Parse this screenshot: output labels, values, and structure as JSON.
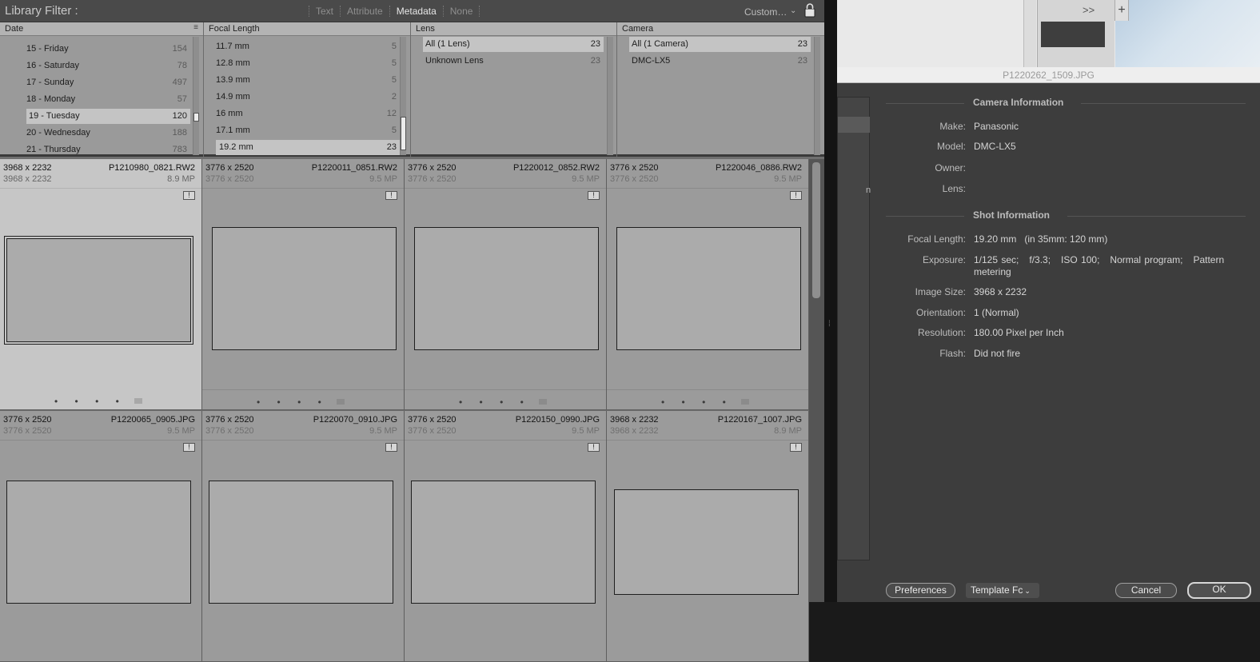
{
  "library_filter": {
    "title": "Library Filter :",
    "modes": [
      "Text",
      "Attribute",
      "Metadata",
      "None"
    ],
    "active_mode": "Metadata",
    "preset": "Custom…",
    "preset_chevron": "⌄"
  },
  "columns": {
    "date": {
      "header": "Date",
      "rows": [
        {
          "label": "15 - Friday",
          "count": "154"
        },
        {
          "label": "16 - Saturday",
          "count": "78"
        },
        {
          "label": "17 - Sunday",
          "count": "497"
        },
        {
          "label": "18 - Monday",
          "count": "57"
        },
        {
          "label": "19 - Tuesday",
          "count": "120"
        },
        {
          "label": "20 - Wednesday",
          "count": "188"
        },
        {
          "label": "21 - Thursday",
          "count": "783"
        }
      ],
      "selected_index": 4
    },
    "focal_length": {
      "header": "Focal Length",
      "rows": [
        {
          "label": "11.7 mm",
          "count": "5"
        },
        {
          "label": "12.8 mm",
          "count": "5"
        },
        {
          "label": "13.9 mm",
          "count": "5"
        },
        {
          "label": "14.9 mm",
          "count": "2"
        },
        {
          "label": "16 mm",
          "count": "12"
        },
        {
          "label": "17.1 mm",
          "count": "5"
        },
        {
          "label": "19.2 mm",
          "count": "23"
        }
      ],
      "selected_index": 6
    },
    "lens": {
      "header": "Lens",
      "rows": [
        {
          "label": "All (1 Lens)",
          "count": "23"
        },
        {
          "label": "Unknown Lens",
          "count": "23"
        }
      ],
      "selected_index": 0
    },
    "camera": {
      "header": "Camera",
      "rows": [
        {
          "label": "All (1 Camera)",
          "count": "23"
        },
        {
          "label": "DMC-LX5",
          "count": "23"
        }
      ],
      "selected_index": 0
    }
  },
  "grid": [
    {
      "dims": "3968 x 2232",
      "fname": "P1210980_0821.RW2",
      "dims2": "3968 x 2232",
      "mp": "8.9 MP",
      "selected": true
    },
    {
      "dims": "3776 x 2520",
      "fname": "P1220011_0851.RW2",
      "dims2": "3776 x 2520",
      "mp": "9.5 MP"
    },
    {
      "dims": "3776 x 2520",
      "fname": "P1220012_0852.RW2",
      "dims2": "3776 x 2520",
      "mp": "9.5 MP"
    },
    {
      "dims": "3776 x 2520",
      "fname": "P1220046_0886.RW2",
      "dims2": "3776 x 2520",
      "mp": "9.5 MP"
    },
    {
      "dims": "3776 x 2520",
      "fname": "P1220065_0905.JPG",
      "dims2": "3776 x 2520",
      "mp": "9.5 MP"
    },
    {
      "dims": "3776 x 2520",
      "fname": "P1220070_0910.JPG",
      "dims2": "3776 x 2520",
      "mp": "9.5 MP"
    },
    {
      "dims": "3776 x 2520",
      "fname": "P1220150_0990.JPG",
      "dims2": "3776 x 2520",
      "mp": "9.5 MP"
    },
    {
      "dims": "3968 x 2232",
      "fname": "P1220167_1007.JPG",
      "dims2": "3968 x 2232",
      "mp": "8.9 MP"
    }
  ],
  "grid_labels": {
    "warning_glyph": "!",
    "dots": "• • • • •"
  },
  "browser": {
    "overflow_chevron": ">>",
    "new_tab": "+"
  },
  "info_window": {
    "title": "P1220262_1509.JPG",
    "camera_section": "Camera Information",
    "camera_fields": [
      {
        "key": "Make:",
        "value": "Panasonic"
      },
      {
        "key": "Model:",
        "value": "DMC-LX5"
      },
      {
        "key": "Owner:",
        "value": ""
      },
      {
        "key": "Lens:",
        "value": ""
      }
    ],
    "shot_section": "Shot Information",
    "shot_fields": [
      {
        "key": "Focal Length:",
        "value": "19.20 mm   (in 35mm: 120 mm)"
      },
      {
        "key": "Exposure:",
        "value": "1/125 sec;   f/3.3;   ISO 100;   Normal program;   Pattern metering"
      },
      {
        "key": "Image Size:",
        "value": "3968 x 2232"
      },
      {
        "key": "Orientation:",
        "value": "1 (Normal)"
      },
      {
        "key": "Resolution:",
        "value": "180.00 Pixel per Inch"
      },
      {
        "key": "Flash:",
        "value": "Did not fire"
      }
    ],
    "left_list_fragment": "n",
    "buttons": {
      "preferences": "Preferences",
      "template": "Template Fc",
      "cancel": "Cancel",
      "ok": "OK"
    }
  },
  "colors": {
    "accent_selected_cell": "#c6c6c6",
    "panel_bg": "#3d3d3d",
    "filter_bg": "#4a4a4a"
  }
}
